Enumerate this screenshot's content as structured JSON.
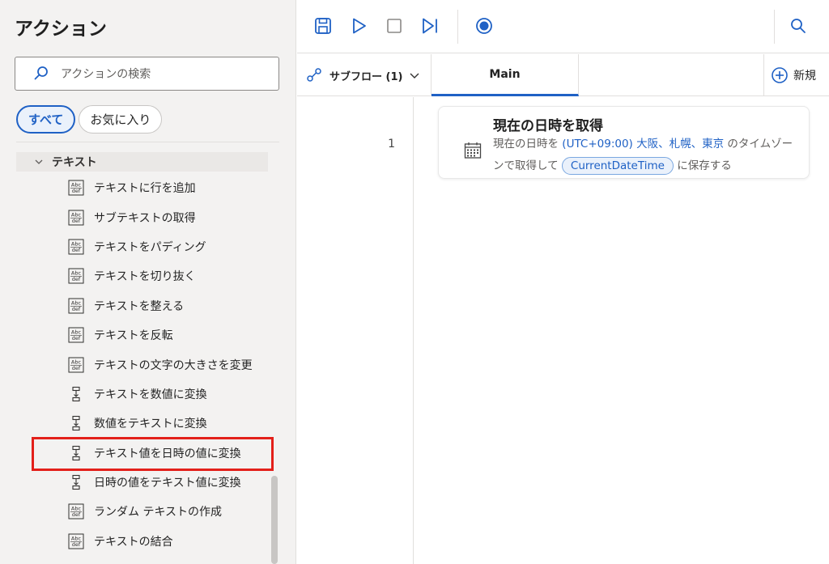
{
  "actions_pane": {
    "title": "アクション",
    "search_placeholder": "アクションの検索",
    "filters": [
      {
        "label": "すべて",
        "active": true
      },
      {
        "label": "お気に入り",
        "active": false
      }
    ],
    "group": {
      "label": "テキスト",
      "expanded": true
    },
    "items": [
      {
        "label": "テキストに行を追加",
        "icon": "abc-def-icon"
      },
      {
        "label": "サブテキストの取得",
        "icon": "abc-def-icon"
      },
      {
        "label": "テキストをパディング",
        "icon": "abc-def-icon"
      },
      {
        "label": "テキストを切り抜く",
        "icon": "abc-def-icon"
      },
      {
        "label": "テキストを整える",
        "icon": "abc-def-icon"
      },
      {
        "label": "テキストを反転",
        "icon": "abc-def-icon"
      },
      {
        "label": "テキストの文字の大きさを変更",
        "icon": "abc-def-icon"
      },
      {
        "label": "テキストを数値に変換",
        "icon": "convert-icon"
      },
      {
        "label": "数値をテキストに変換",
        "icon": "convert-icon"
      },
      {
        "label": "テキスト値を日時の値に変換",
        "icon": "convert-icon",
        "highlighted": true
      },
      {
        "label": "日時の値をテキスト値に変換",
        "icon": "convert-icon"
      },
      {
        "label": "ランダム テキストの作成",
        "icon": "abc-def-icon"
      },
      {
        "label": "テキストの結合",
        "icon": "abc-def-icon"
      }
    ]
  },
  "toolbar": {
    "buttons": [
      "save-icon",
      "run-icon",
      "stop-icon",
      "run-next-icon",
      "record-icon",
      "search-icon"
    ]
  },
  "tabs": {
    "subflow_label": "サブフロー (1)",
    "main_label": "Main",
    "new_label": "新規"
  },
  "flow": {
    "steps": [
      {
        "line": "1",
        "title": "現在の日時を取得",
        "desc_prefix": "現在の日時を ",
        "desc_timezone": "(UTC+09:00) 大阪、札幌、東京",
        "desc_mid": " のタイムゾーンで取得して ",
        "variable": "CurrentDateTime",
        "desc_suffix": " に保存する"
      }
    ]
  },
  "colors": {
    "accent": "#1f61c5",
    "highlight_border": "#e3201a",
    "pane_bg": "#f3f2f1"
  }
}
